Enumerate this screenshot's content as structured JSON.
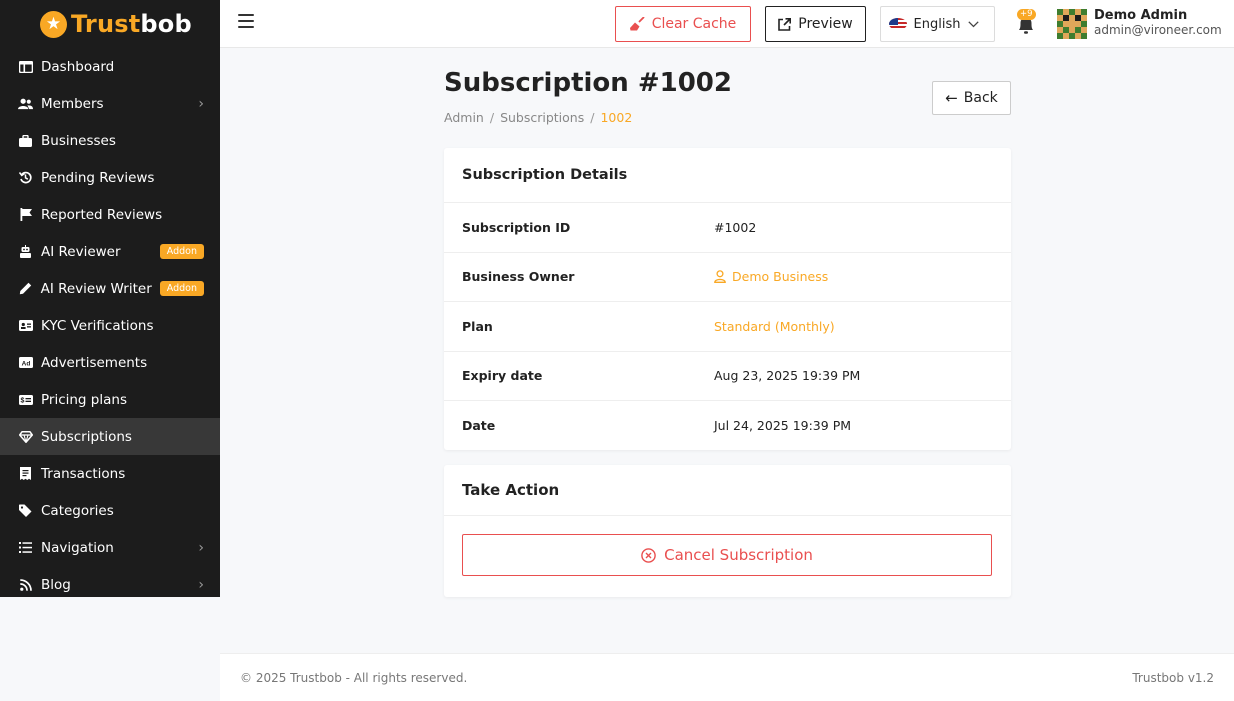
{
  "brand": {
    "name_part1": "Trust",
    "name_part2": "bob"
  },
  "sidebar": {
    "items": [
      {
        "label": "Dashboard",
        "icon": "dashboard-icon"
      },
      {
        "label": "Members",
        "icon": "users-icon",
        "has_submenu": true
      },
      {
        "label": "Businesses",
        "icon": "briefcase-icon"
      },
      {
        "label": "Pending Reviews",
        "icon": "history-icon"
      },
      {
        "label": "Reported Reviews",
        "icon": "flag-icon"
      },
      {
        "label": "AI Reviewer",
        "icon": "robot-icon",
        "badge": "Addon"
      },
      {
        "label": "AI Review Writer",
        "icon": "pencil-icon",
        "badge": "Addon"
      },
      {
        "label": "KYC Verifications",
        "icon": "id-card-icon"
      },
      {
        "label": "Advertisements",
        "icon": "ad-icon"
      },
      {
        "label": "Pricing plans",
        "icon": "money-icon"
      },
      {
        "label": "Subscriptions",
        "icon": "gem-icon",
        "active": true
      },
      {
        "label": "Transactions",
        "icon": "receipt-icon"
      },
      {
        "label": "Categories",
        "icon": "tags-icon"
      },
      {
        "label": "Navigation",
        "icon": "list-icon",
        "has_submenu": true
      },
      {
        "label": "Blog",
        "icon": "rss-icon",
        "has_submenu": true
      }
    ]
  },
  "topbar": {
    "clear_cache_label": "Clear Cache",
    "preview_label": "Preview",
    "language_label": "English",
    "notification_count": "+9",
    "user_name": "Demo Admin",
    "user_email": "admin@vironeer.com"
  },
  "page": {
    "title": "Subscription #1002",
    "breadcrumb": [
      "Admin",
      "Subscriptions",
      "1002"
    ],
    "back_label": "Back"
  },
  "details": {
    "heading": "Subscription Details",
    "rows": [
      {
        "label": "Subscription ID",
        "value": "#1002"
      },
      {
        "label": "Business Owner",
        "value": "Demo Business"
      },
      {
        "label": "Plan",
        "value": "Standard (Monthly)"
      },
      {
        "label": "Expiry date",
        "value": "Aug 23, 2025 19:39 PM"
      },
      {
        "label": "Date",
        "value": "Jul 24, 2025 19:39 PM"
      }
    ]
  },
  "action": {
    "heading": "Take Action",
    "cancel_label": "Cancel Subscription"
  },
  "footer": {
    "copyright": "© 2025 Trustbob - All rights reserved.",
    "version": "Trustbob v1.2"
  },
  "colors": {
    "accent": "#f9a825",
    "danger": "#e94f4f",
    "sidebar_bg": "#1c1c1c",
    "sidebar_active": "#383838"
  }
}
